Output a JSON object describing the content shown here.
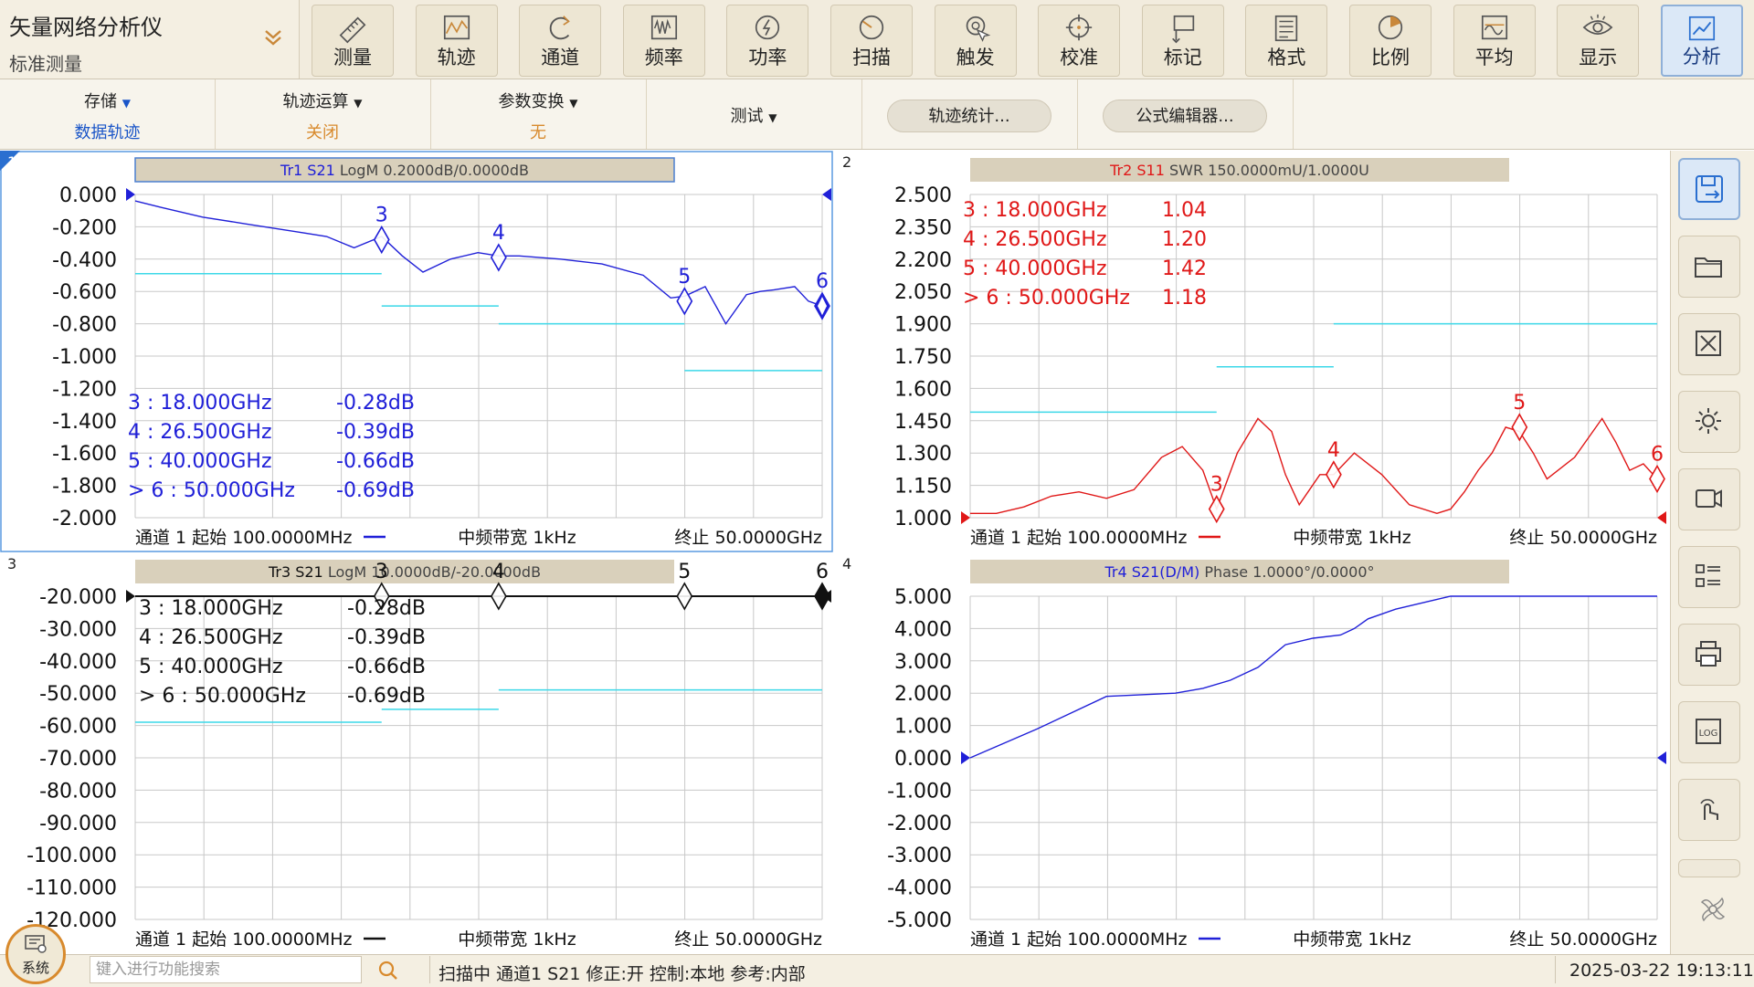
{
  "app": {
    "title": "矢量网络分析仪",
    "subtitle": "标准测量"
  },
  "toolbar": {
    "buttons": [
      {
        "label": "测量",
        "icon": "ruler-icon"
      },
      {
        "label": "轨迹",
        "icon": "trace-icon"
      },
      {
        "label": "通道",
        "icon": "channel-icon"
      },
      {
        "label": "频率",
        "icon": "frequency-icon"
      },
      {
        "label": "功率",
        "icon": "power-icon"
      },
      {
        "label": "扫描",
        "icon": "sweep-icon"
      },
      {
        "label": "触发",
        "icon": "trigger-icon"
      },
      {
        "label": "校准",
        "icon": "calibrate-icon"
      },
      {
        "label": "标记",
        "icon": "marker-icon"
      },
      {
        "label": "格式",
        "icon": "format-icon"
      },
      {
        "label": "比例",
        "icon": "scale-icon"
      },
      {
        "label": "平均",
        "icon": "average-icon"
      },
      {
        "label": "显示",
        "icon": "display-icon"
      },
      {
        "label": "分析",
        "icon": "analysis-icon",
        "active": true
      }
    ]
  },
  "subbar": {
    "storage": {
      "label": "存储",
      "value": "数据轨迹"
    },
    "trace_math": {
      "label": "轨迹运算",
      "value": "关闭"
    },
    "param_convert": {
      "label": "参数变换",
      "value": "无"
    },
    "test": {
      "label": "测试"
    },
    "trace_stats": "轨迹统计...",
    "formula_editor": "公式编辑器..."
  },
  "colors": {
    "blue": "#2020d8",
    "red": "#e01818",
    "cyan": "#3cd8e8",
    "accent": "#d88a2d",
    "marker_blue": "#1a1ad0"
  },
  "panels": [
    {
      "number": "1",
      "header": "Tr1 S21 LogM 0.2000dB/0.0000dB",
      "header_prefix": "Tr1 S21",
      "header_rest": " LogM 0.2000dB/0.0000dB",
      "color": "#2020d8",
      "ylim": [
        -2.0,
        0.0
      ],
      "yticks": [
        "0.000",
        "-0.200",
        "-0.400",
        "-0.600",
        "-0.800",
        "-1.000",
        "-1.200",
        "-1.400",
        "-1.600",
        "-1.800",
        "-2.000"
      ],
      "footer": {
        "left": "通道 1 起始 100.0000MHz",
        "mid": "中频带宽 1kHz",
        "right": "终止 50.0000GHz"
      },
      "markers_table": [
        {
          "id": "3",
          "freq": "18.000GHz",
          "val": "-0.28dB",
          "active": false
        },
        {
          "id": "4",
          "freq": "26.500GHz",
          "val": "-0.39dB",
          "active": false
        },
        {
          "id": "5",
          "freq": "40.000GHz",
          "val": "-0.66dB",
          "active": false
        },
        {
          "id": "6",
          "freq": "50.000GHz",
          "val": "-0.69dB",
          "active": true
        }
      ]
    },
    {
      "number": "2",
      "header": "Tr2 S11 SWR 150.0000mU/1.0000U",
      "header_prefix": "Tr2 S11",
      "header_rest": " SWR 150.0000mU/1.0000U",
      "color": "#e01818",
      "ylim": [
        1.0,
        2.5
      ],
      "yticks": [
        "2.500",
        "2.350",
        "2.200",
        "2.050",
        "1.900",
        "1.750",
        "1.600",
        "1.450",
        "1.300",
        "1.150",
        "1.000"
      ],
      "footer": {
        "left": "通道 1 起始 100.0000MHz",
        "mid": "中频带宽 1kHz",
        "right": "终止 50.0000GHz"
      },
      "markers_table": [
        {
          "id": "3",
          "freq": "18.000GHz",
          "val": "1.04",
          "active": false
        },
        {
          "id": "4",
          "freq": "26.500GHz",
          "val": "1.20",
          "active": false
        },
        {
          "id": "5",
          "freq": "40.000GHz",
          "val": "1.42",
          "active": false
        },
        {
          "id": "6",
          "freq": "50.000GHz",
          "val": "1.18",
          "active": true
        }
      ]
    },
    {
      "number": "3",
      "header": "Tr3 S21 LogM 10.0000dB/-20.0000dB",
      "header_prefix": "Tr3 S21",
      "header_rest": " LogM 10.0000dB/-20.0000dB",
      "color": "#111111",
      "ylim": [
        -120.0,
        -20.0
      ],
      "yticks": [
        "-20.000",
        "-30.000",
        "-40.000",
        "-50.000",
        "-60.000",
        "-70.000",
        "-80.000",
        "-90.000",
        "-100.000",
        "-110.000",
        "-120.000"
      ],
      "footer": {
        "left": "通道 1 起始 100.0000MHz",
        "mid": "中频带宽 1kHz",
        "right": "终止 50.0000GHz"
      },
      "markers_table": [
        {
          "id": "3",
          "freq": "18.000GHz",
          "val": "-0.28dB",
          "active": false
        },
        {
          "id": "4",
          "freq": "26.500GHz",
          "val": "-0.39dB",
          "active": false
        },
        {
          "id": "5",
          "freq": "40.000GHz",
          "val": "-0.66dB",
          "active": false
        },
        {
          "id": "6",
          "freq": "50.000GHz",
          "val": "-0.69dB",
          "active": true
        }
      ]
    },
    {
      "number": "4",
      "header": "Tr4 S21(D/M) Phase 1.0000°/0.0000°",
      "header_prefix": "Tr4 S21(D/M)",
      "header_rest": " Phase 1.0000°/0.0000°",
      "color": "#2020d8",
      "ylim": [
        -5.0,
        5.0
      ],
      "yticks": [
        "5.000",
        "4.000",
        "3.000",
        "2.000",
        "1.000",
        "0.000",
        "-1.000",
        "-2.000",
        "-3.000",
        "-4.000",
        "-5.000"
      ],
      "footer": {
        "left": "通道 1 起始 100.0000MHz",
        "mid": "中频带宽 1kHz",
        "right": "终止 50.0000GHz"
      },
      "markers_table": []
    }
  ],
  "chart_data": [
    {
      "type": "line",
      "title": "Tr1 S21 LogM 0.2000dB/0.0000dB",
      "xlabel": "",
      "ylabel": "",
      "xlim": [
        0.1,
        50.0
      ],
      "ylim": [
        -2.0,
        0.0
      ],
      "grid": true,
      "series": [
        {
          "name": "Tr1 S21",
          "color": "#2020d8",
          "x": [
            0.1,
            2,
            5,
            8,
            11,
            14,
            16,
            18,
            19.5,
            21,
            23,
            25,
            26.5,
            28,
            31,
            34,
            37,
            39,
            40,
            41.5,
            43,
            44.5,
            45.5,
            46.5,
            48,
            49,
            50
          ],
          "y": [
            -0.04,
            -0.08,
            -0.14,
            -0.18,
            -0.22,
            -0.26,
            -0.33,
            -0.26,
            -0.38,
            -0.48,
            -0.4,
            -0.36,
            -0.38,
            -0.38,
            -0.4,
            -0.43,
            -0.5,
            -0.64,
            -0.63,
            -0.57,
            -0.8,
            -0.62,
            -0.6,
            -0.59,
            -0.57,
            -0.66,
            -0.69
          ]
        }
      ],
      "limit_lines": [
        {
          "x": [
            0.1,
            18.0
          ],
          "y": -0.49
        },
        {
          "x": [
            18.0,
            26.5
          ],
          "y": -0.69
        },
        {
          "x": [
            26.5,
            40.0
          ],
          "y": -0.8
        },
        {
          "x": [
            40.0,
            50.0
          ],
          "y": -1.09
        }
      ],
      "markers": [
        {
          "id": "3",
          "x": 18.0,
          "y": -0.28
        },
        {
          "id": "4",
          "x": 26.5,
          "y": -0.39
        },
        {
          "id": "5",
          "x": 40.0,
          "y": -0.66
        },
        {
          "id": "6",
          "x": 50.0,
          "y": -0.69
        }
      ]
    },
    {
      "type": "line",
      "title": "Tr2 S11 SWR 150.0000mU/1.0000U",
      "xlabel": "",
      "ylabel": "",
      "xlim": [
        0.1,
        50.0
      ],
      "ylim": [
        1.0,
        2.5
      ],
      "grid": true,
      "series": [
        {
          "name": "Tr2 S11",
          "color": "#e01818",
          "x": [
            0.1,
            2,
            4,
            6,
            8,
            10,
            12,
            14,
            15.5,
            17,
            18,
            19.5,
            21,
            22,
            23,
            24,
            25.5,
            26.5,
            28,
            30,
            32,
            34,
            35,
            36,
            37,
            38,
            39,
            40,
            41,
            42,
            44,
            46,
            47,
            48,
            49,
            50
          ],
          "y": [
            1.02,
            1.02,
            1.05,
            1.1,
            1.12,
            1.09,
            1.13,
            1.28,
            1.33,
            1.22,
            1.04,
            1.3,
            1.46,
            1.4,
            1.2,
            1.06,
            1.2,
            1.2,
            1.3,
            1.2,
            1.06,
            1.02,
            1.04,
            1.12,
            1.22,
            1.3,
            1.42,
            1.4,
            1.3,
            1.18,
            1.28,
            1.46,
            1.35,
            1.22,
            1.25,
            1.18
          ]
        }
      ],
      "limit_lines": [
        {
          "x": [
            0.1,
            18.0
          ],
          "y": 1.49
        },
        {
          "x": [
            18.0,
            26.5
          ],
          "y": 1.7
        },
        {
          "x": [
            26.5,
            50.0
          ],
          "y": 1.9
        }
      ],
      "markers": [
        {
          "id": "3",
          "x": 18.0,
          "y": 1.04
        },
        {
          "id": "4",
          "x": 26.5,
          "y": 1.2
        },
        {
          "id": "5",
          "x": 40.0,
          "y": 1.42
        },
        {
          "id": "6",
          "x": 50.0,
          "y": 1.18
        }
      ]
    },
    {
      "type": "line",
      "title": "Tr3 S21 LogM 10.0000dB/-20.0000dB",
      "xlabel": "",
      "ylabel": "",
      "xlim": [
        0.1,
        50.0
      ],
      "ylim": [
        -120.0,
        -20.0
      ],
      "grid": true,
      "series": [
        {
          "name": "Tr3 S21",
          "color": "#111111",
          "x": [
            0.1,
            50.0
          ],
          "y": [
            -20.0,
            -20.0
          ]
        }
      ],
      "limit_lines": [
        {
          "x": [
            0.1,
            18.0
          ],
          "y": -59.0
        },
        {
          "x": [
            18.0,
            26.5
          ],
          "y": -55.0
        },
        {
          "x": [
            26.5,
            50.0
          ],
          "y": -49.0
        }
      ],
      "markers": [
        {
          "id": "3",
          "x": 18.0,
          "y": -20.0
        },
        {
          "id": "4",
          "x": 26.5,
          "y": -20.0
        },
        {
          "id": "5",
          "x": 40.0,
          "y": -20.0
        },
        {
          "id": "6",
          "x": 50.0,
          "y": -20.0
        }
      ]
    },
    {
      "type": "line",
      "title": "Tr4 S21(D/M) Phase 1.0000°/0.0000°",
      "xlabel": "",
      "ylabel": "",
      "xlim": [
        0.1,
        50.0
      ],
      "ylim": [
        -5.0,
        5.0
      ],
      "grid": true,
      "series": [
        {
          "name": "Tr4 S21(D/M)",
          "color": "#2020d8",
          "x": [
            0.1,
            5,
            10,
            15,
            17,
            19,
            21,
            23,
            25,
            27,
            28,
            29,
            31,
            33,
            35,
            37,
            40,
            50
          ],
          "y": [
            0.0,
            0.9,
            1.9,
            2.0,
            2.15,
            2.4,
            2.8,
            3.5,
            3.7,
            3.8,
            4.0,
            4.3,
            4.6,
            4.8,
            5.0,
            5.0,
            5.0,
            5.0
          ]
        }
      ],
      "limit_lines": [],
      "markers": []
    }
  ],
  "sidebar": {
    "buttons": [
      {
        "icon": "save-trace-icon",
        "active": true
      },
      {
        "icon": "folder-open-icon"
      },
      {
        "icon": "screenshot-icon"
      },
      {
        "icon": "settings-gear-icon"
      },
      {
        "icon": "recording-icon"
      },
      {
        "icon": "list-icon"
      },
      {
        "icon": "printer-icon"
      },
      {
        "icon": "log-icon"
      },
      {
        "icon": "touch-icon"
      }
    ]
  },
  "status": {
    "system_label": "系统",
    "search_placeholder": "键入进行功能搜索",
    "text": "扫描中 通道1 S21 修正:开 控制:本地 参考:内部",
    "datetime": "2025-03-22 19:13:11"
  }
}
